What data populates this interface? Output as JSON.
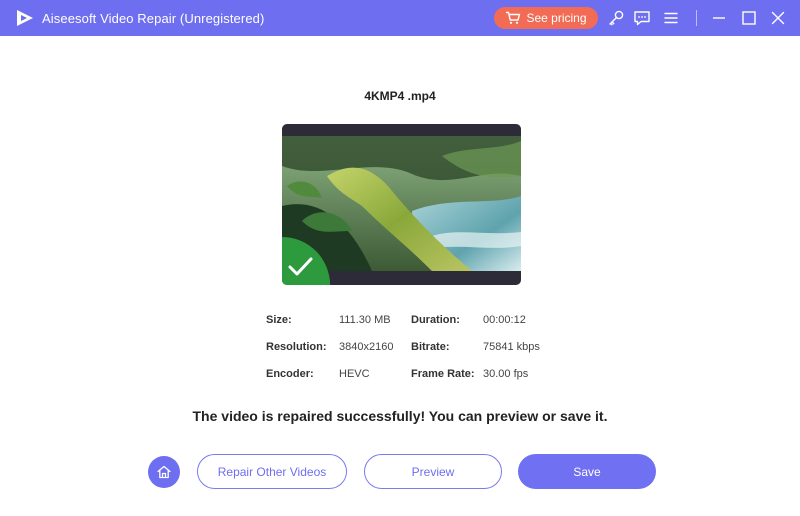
{
  "window": {
    "title": "Aiseesoft Video Repair (Unregistered)",
    "logo_icon": "play-logo-icon",
    "accent_color": "#6e6ef0"
  },
  "toolbar": {
    "pricing_label": "See pricing",
    "pricing_color": "#f26b55",
    "icons": [
      "cart-icon",
      "key-icon",
      "chat-icon",
      "menu-icon",
      "minimize-icon",
      "maximize-icon",
      "close-icon"
    ]
  },
  "file": {
    "name": "4KMP4 .mp4",
    "status_icon": "checkmark-icon",
    "status_color": "#2e9a3e"
  },
  "info": {
    "size_label": "Size:",
    "size_value": "111.30 MB",
    "duration_label": "Duration:",
    "duration_value": "00:00:12",
    "resolution_label": "Resolution:",
    "resolution_value": "3840x2160",
    "bitrate_label": "Bitrate:",
    "bitrate_value": "75841 kbps",
    "encoder_label": "Encoder:",
    "encoder_value": "HEVC",
    "framerate_label": "Frame Rate:",
    "framerate_value": "30.00 fps"
  },
  "message": "The video is repaired successfully! You can preview or save it.",
  "actions": {
    "home_icon": "home-icon",
    "repair_other_label": "Repair Other Videos",
    "preview_label": "Preview",
    "save_label": "Save"
  }
}
